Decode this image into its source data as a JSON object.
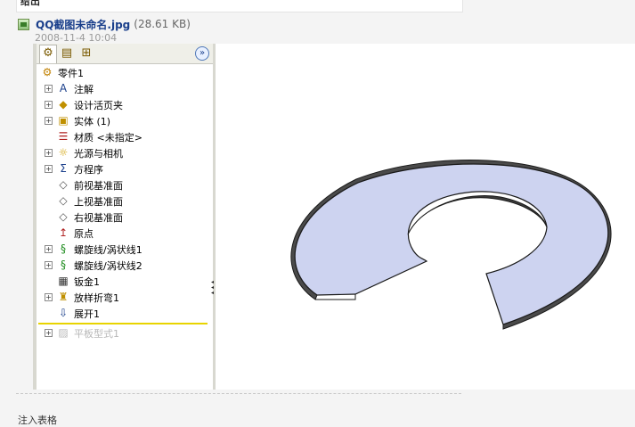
{
  "post": {
    "top_text": "给出",
    "footer_text": "注入表格"
  },
  "attachment": {
    "icon": "image-file-icon",
    "filename": "QQ截图未命名.jpg",
    "size": "(28.61 KB)",
    "timestamp": "2008-11-4 10:04"
  },
  "toolbar": {
    "buttons": [
      "featuremanager-tab-icon",
      "propertymanager-tab-icon",
      "configurationmanager-tab-icon"
    ],
    "expand_icon": "double-chevron-right-icon",
    "expand_glyph": "»"
  },
  "tree": {
    "root": {
      "label": "零件1",
      "icon": "part-icon"
    },
    "items": [
      {
        "label": "注解",
        "icon": "annotations-icon",
        "expandable": true
      },
      {
        "label": "设计活页夹",
        "icon": "design-binder-icon",
        "expandable": true
      },
      {
        "label": "实体 (1)",
        "icon": "solid-bodies-icon",
        "expandable": true
      },
      {
        "label": "材质 <未指定>",
        "icon": "material-icon",
        "expandable": false
      },
      {
        "label": "光源与相机",
        "icon": "lights-cameras-icon",
        "expandable": true
      },
      {
        "label": "方程序",
        "icon": "equations-icon",
        "expandable": true
      },
      {
        "label": "前视基准面",
        "icon": "plane-icon",
        "expandable": false
      },
      {
        "label": "上视基准面",
        "icon": "plane-icon",
        "expandable": false
      },
      {
        "label": "右视基准面",
        "icon": "plane-icon",
        "expandable": false
      },
      {
        "label": "原点",
        "icon": "origin-icon",
        "expandable": false
      },
      {
        "label": "螺旋线/涡状线1",
        "icon": "helix-icon",
        "expandable": true
      },
      {
        "label": "螺旋线/涡状线2",
        "icon": "helix-icon",
        "expandable": true
      },
      {
        "label": "钣金1",
        "icon": "sheet-metal-icon",
        "expandable": false
      },
      {
        "label": "放样折弯1",
        "icon": "lofted-bend-icon",
        "expandable": true
      },
      {
        "label": "展开1",
        "icon": "unfold-icon",
        "expandable": false
      }
    ],
    "suppressed": {
      "label": "平板型式1",
      "icon": "flat-pattern-icon",
      "expandable": true
    }
  },
  "colors": {
    "face_fill": "#cdd3f0",
    "edge_stroke": "#1a1a1a",
    "rollback_bar": "#e8d400",
    "link": "#1a3f8b"
  }
}
